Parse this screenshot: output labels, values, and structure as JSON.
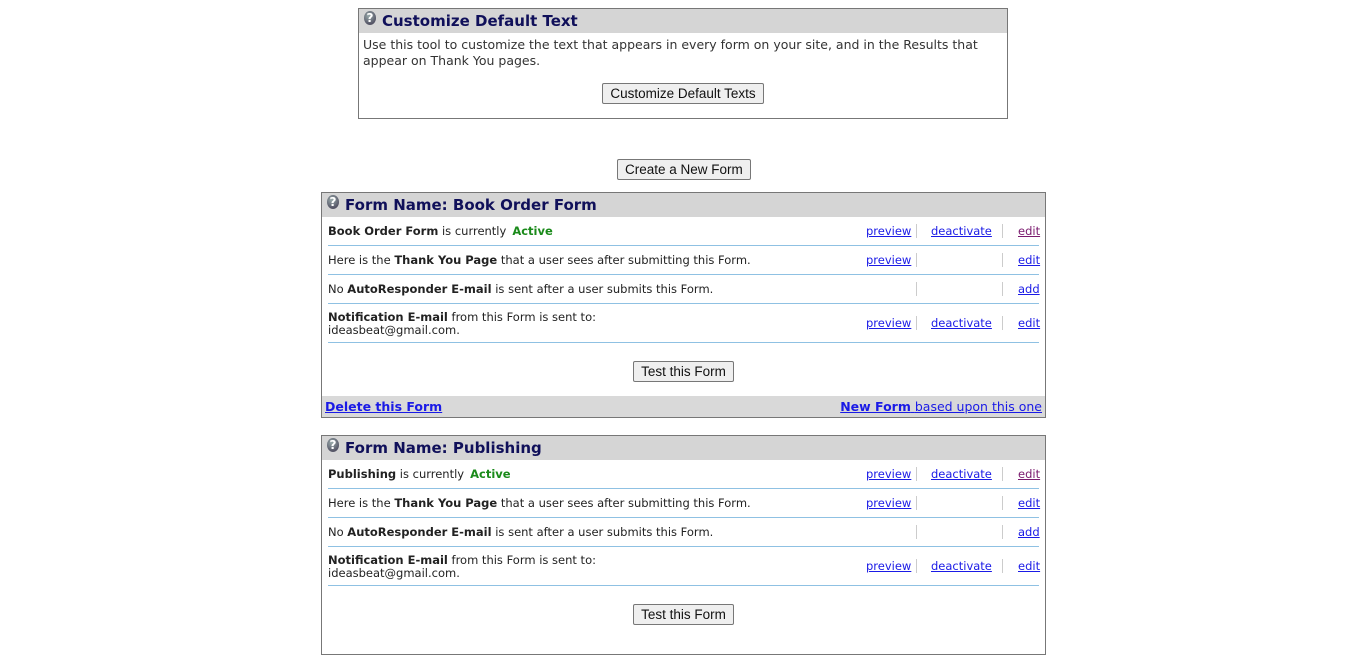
{
  "customize": {
    "title": "Customize Default Text",
    "description": "Use this tool to customize the text that appears in every form on your site, and in the Results that appear on Thank You pages.",
    "button": "Customize Default Texts"
  },
  "create_button": "Create a New Form",
  "forms": [
    {
      "title": "Form Name: Book Order Form",
      "name": "Book Order Form",
      "status_text": "is currently",
      "status": "Active",
      "thank_you": {
        "pre": "Here is the",
        "bold": "Thank You Page",
        "post": "that a user sees after submitting this Form."
      },
      "autoresponder": {
        "pre": "No",
        "bold": "AutoResponder E-mail",
        "post": "is sent after a user submits this Form."
      },
      "notification": {
        "bold": "Notification E-mail",
        "post": "from this Form is sent to:",
        "email": "ideasbeat@gmail.com."
      },
      "links": {
        "preview": "preview",
        "deactivate": "deactivate",
        "edit": "edit",
        "add": "add"
      },
      "test_button": "Test this Form",
      "delete_link": "Delete this Form",
      "new_form_link": "New Form",
      "new_form_suffix": "based upon this one"
    },
    {
      "title": "Form Name: Publishing",
      "name": "Publishing",
      "status_text": "is currently",
      "status": "Active",
      "thank_you": {
        "pre": "Here is the",
        "bold": "Thank You Page",
        "post": "that a user sees after submitting this Form."
      },
      "autoresponder": {
        "pre": "No",
        "bold": "AutoResponder E-mail",
        "post": "is sent after a user submits this Form."
      },
      "notification": {
        "bold": "Notification E-mail",
        "post": "from this Form is sent to:",
        "email": "ideasbeat@gmail.com."
      },
      "links": {
        "preview": "preview",
        "deactivate": "deactivate",
        "edit": "edit",
        "add": "add"
      },
      "test_button": "Test this Form"
    }
  ],
  "help_icon": "question-mark-icon"
}
